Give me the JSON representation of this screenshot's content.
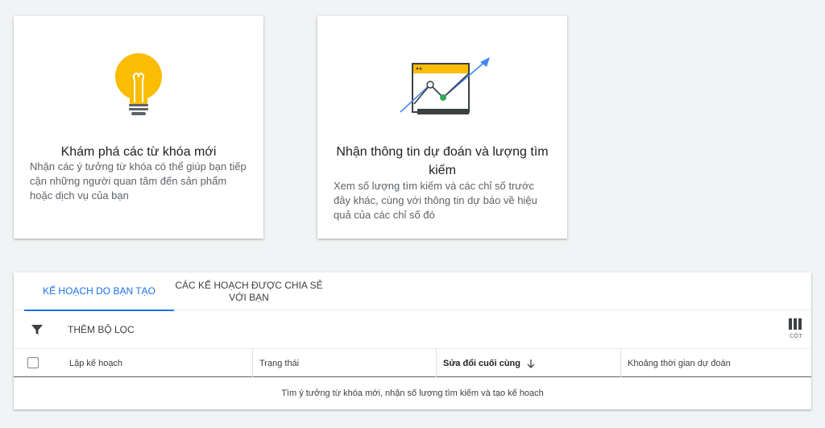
{
  "cards": [
    {
      "title": "Khám phá các từ khóa mới",
      "description": "Nhận các ý tưởng từ khóa có thể giúp bạn tiếp cận những người quan tâm đến sản phẩm hoặc dịch vụ của bạn",
      "icon": "lightbulb-icon"
    },
    {
      "title": "Nhận thông tin dự đoán và lượng tìm kiếm",
      "description": "Xem số lượng tìm kiếm và các chỉ số trước đây khác, cùng với thông tin dự báo về hiệu quả của các chỉ số đó",
      "icon": "trend-chart-icon"
    }
  ],
  "tabs": [
    {
      "label": "Kế hoạch do bạn tạo",
      "active": true
    },
    {
      "label": "Các kế hoạch được chia sẻ với bạn",
      "active": false
    }
  ],
  "toolbar": {
    "filter_label": "Thêm bộ lọc",
    "columns_label": "CỘT"
  },
  "table": {
    "columns": [
      "Lập kế hoạch",
      "Trạng thái",
      "Sửa đổi cuối cùng",
      "Khoảng thời gian dự đoán"
    ],
    "sorted_column": "Sửa đổi cuối cùng",
    "sort_direction": "descending",
    "empty_message": "Tìm ý tưởng từ khóa mới, nhận số lượng tìm kiếm và tạo kế hoạch"
  },
  "colors": {
    "accent": "#1a73e8",
    "bulb": "#fbbc04",
    "trend_arrow": "#4285f4",
    "trend_point": "#34a853"
  }
}
